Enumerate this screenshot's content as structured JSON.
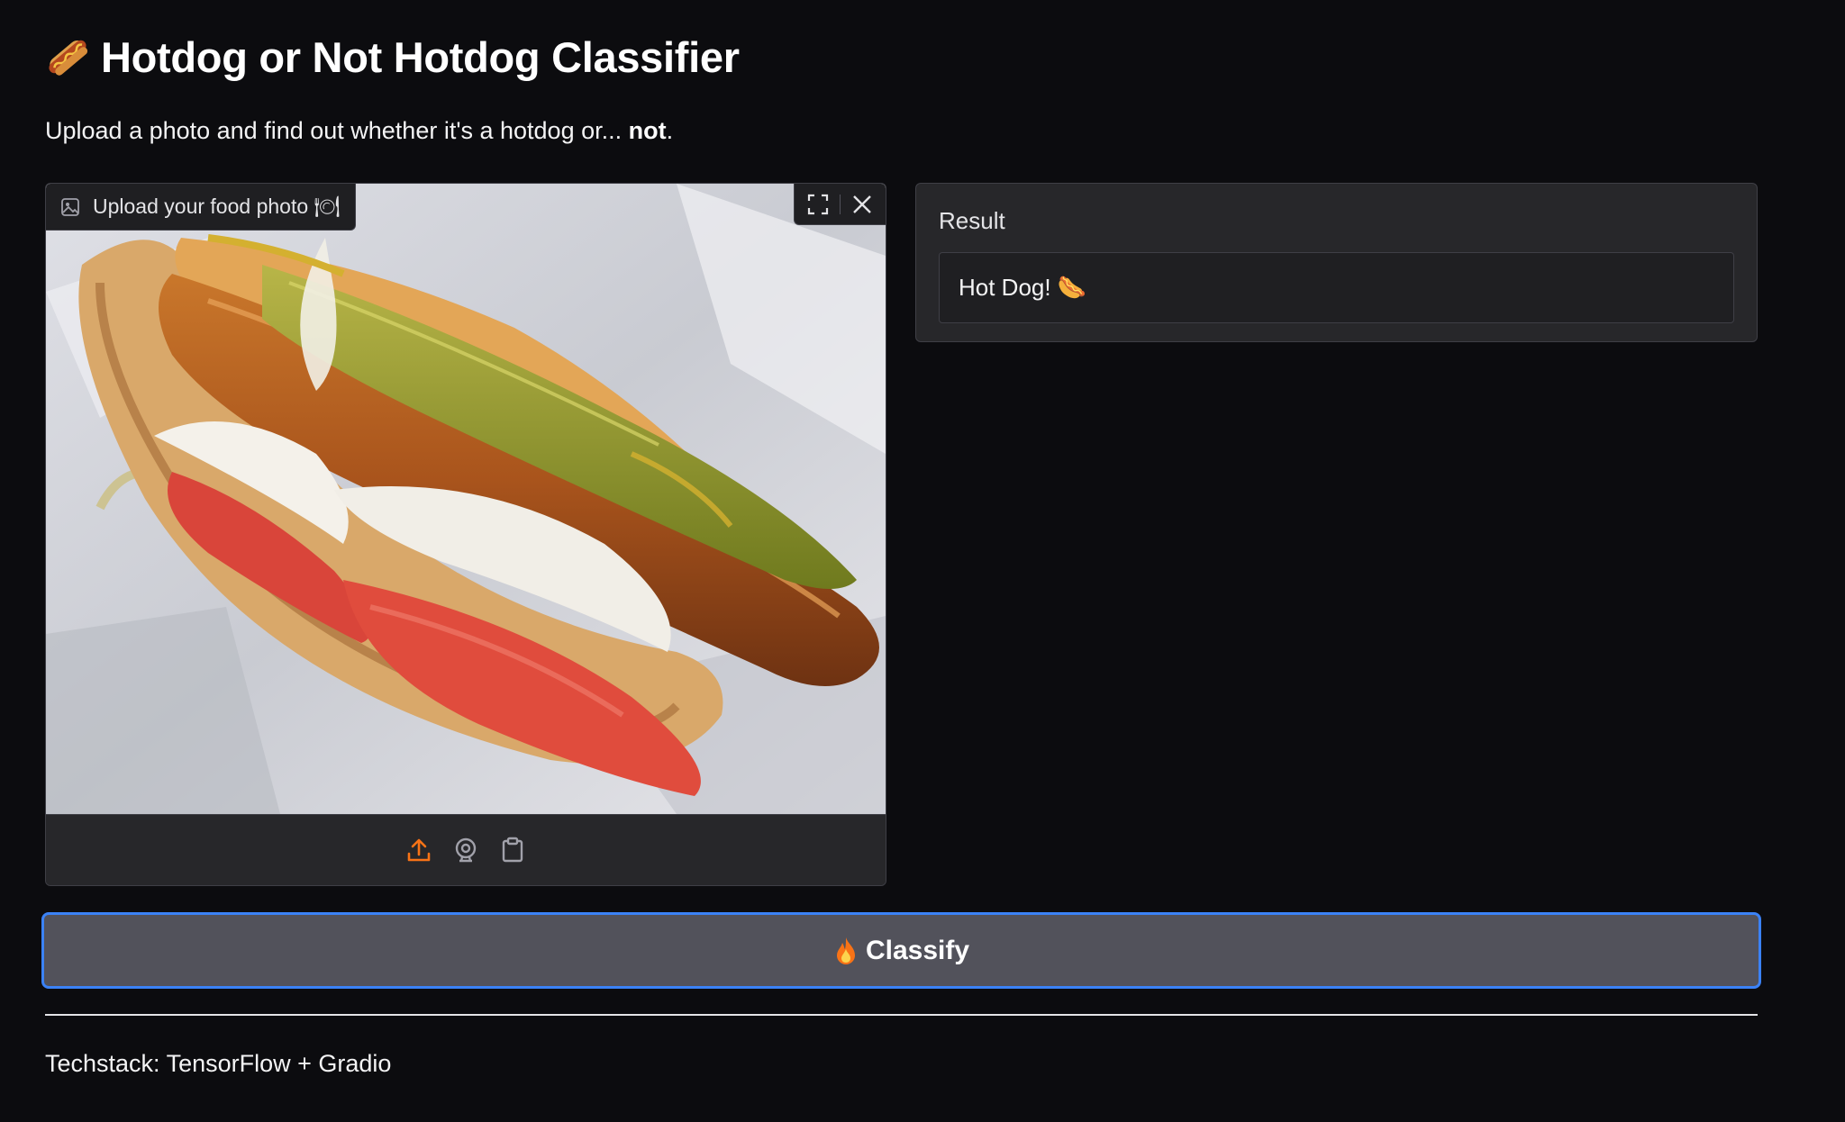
{
  "header": {
    "title": "Hotdog or Not Hotdog Classifier",
    "title_icon": "hotdog-emoji",
    "subtitle_prefix": "Upload a photo and find out whether it's a hotdog or... ",
    "subtitle_bold": "not",
    "subtitle_suffix": "."
  },
  "image_input": {
    "label": "Upload your food photo 🍽",
    "label_icon": "image-icon",
    "tools": [
      "fullscreen-icon",
      "close-icon"
    ],
    "sources": [
      "upload-icon",
      "webcam-icon",
      "clipboard-icon"
    ]
  },
  "result": {
    "label": "Result",
    "value": "Hot Dog! 🌭"
  },
  "classify_button": {
    "label": "Classify",
    "icon": "fire-emoji"
  },
  "footer": {
    "text": "Techstack: TensorFlow + Gradio"
  },
  "colors": {
    "background": "#0c0c0f",
    "panel": "#27272a",
    "border": "#3f3f46",
    "button": "#52525b",
    "button_focus_border": "#3b82f6",
    "accent_orange": "#f97316"
  }
}
